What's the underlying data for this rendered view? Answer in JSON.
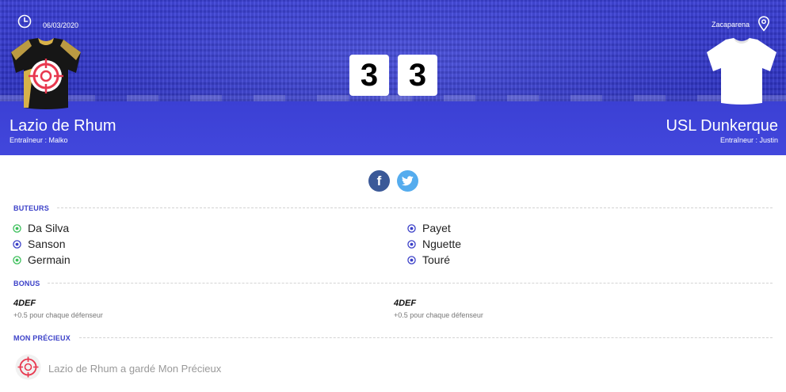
{
  "match": {
    "date": "06/03/2020",
    "venue": "Zacaparena",
    "home": {
      "name": "Lazio de Rhum",
      "coach": "Entraîneur : Malko",
      "score": "3",
      "jersey_icon": "black-gold-jersey-icon"
    },
    "away": {
      "name": "USL Dunkerque",
      "coach": "Entraîneur : Justin",
      "score": "3",
      "jersey_icon": "white-jersey-icon"
    }
  },
  "share": {
    "facebook_icon": "facebook-icon",
    "facebook_glyph": "f",
    "twitter_icon": "twitter-icon"
  },
  "scorers": {
    "title": "BUTEURS",
    "home": [
      "Da Silva",
      "Sanson",
      "Germain"
    ],
    "away": [
      "Payet",
      "Nguette",
      "Touré"
    ]
  },
  "bonus": {
    "title": "BONUS",
    "home": {
      "name": "4DEF",
      "description": "+0.5 pour chaque défenseur"
    },
    "away": {
      "name": "4DEF",
      "description": "+0.5 pour chaque défenseur"
    }
  },
  "precieux": {
    "title": "MON PRÉCIEUX",
    "text": "Lazio de Rhum a gardé Mon Précieux",
    "icon": "target-icon"
  },
  "colors": {
    "hero_blue": "#3136c8",
    "accent": "#3b40c8",
    "home_ball": "#3bbf5a",
    "away_ball": "#3b40c8",
    "target_red": "#e8384f",
    "facebook": "#3b5998",
    "twitter": "#55acee"
  }
}
